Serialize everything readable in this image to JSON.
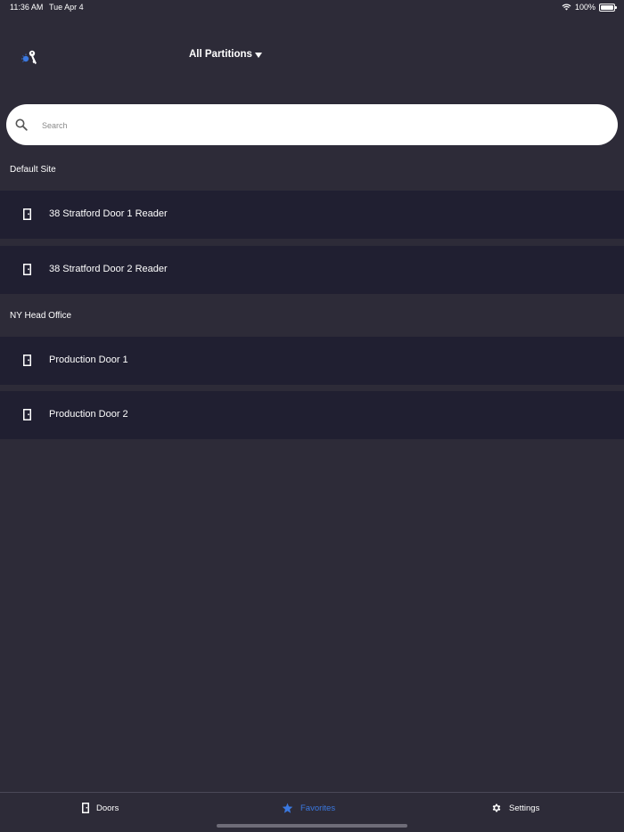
{
  "status_bar": {
    "time": "11:36 AM",
    "date": "Tue Apr 4",
    "battery": "100%"
  },
  "header": {
    "partition_label": "All Partitions"
  },
  "search": {
    "placeholder": "Search",
    "value": ""
  },
  "sections": [
    {
      "title": "Default Site",
      "doors": [
        {
          "label": "38 Stratford Door 1 Reader"
        },
        {
          "label": "38 Stratford Door 2 Reader"
        }
      ]
    },
    {
      "title": "NY Head Office",
      "doors": [
        {
          "label": "Production Door 1"
        },
        {
          "label": "Production Door 2"
        }
      ]
    }
  ],
  "tabs": [
    {
      "label": "Doors",
      "icon": "door-icon"
    },
    {
      "label": "Favorites",
      "icon": "star-icon",
      "active": true
    },
    {
      "label": "Settings",
      "icon": "gear-icon"
    }
  ],
  "colors": {
    "background": "#2d2b38",
    "row_background": "#201f31",
    "accent": "#3a78e0"
  }
}
